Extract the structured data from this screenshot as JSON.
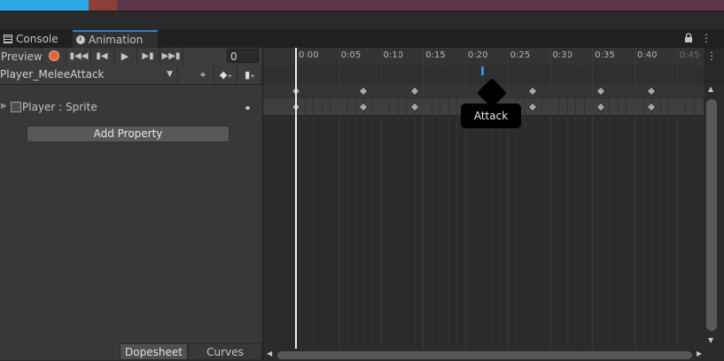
{
  "tabs": [
    {
      "label": "Console",
      "icon": "console-icon"
    },
    {
      "label": "Animation",
      "icon": "animation-icon",
      "active": true
    }
  ],
  "tab_icons": {
    "lock": "lock-icon",
    "menu": "menu-icon"
  },
  "toolbar": {
    "preview_label": "Preview",
    "record_icon": "record-icon",
    "first_key_icon": "first-keyframe-icon",
    "prev_key_icon": "previous-keyframe-icon",
    "play_icon": "play-icon",
    "next_key_icon": "next-keyframe-icon",
    "last_key_icon": "last-keyframe-icon",
    "frame_value": "0"
  },
  "clip": {
    "selected": "Player_MeleeAttack",
    "filter_icon": "filter-keyframe-icon",
    "add_keyframe_icon": "add-keyframe-icon",
    "add_event_icon": "add-event-icon"
  },
  "properties": [
    {
      "label": "Player : Sprite",
      "icon": "sprite-icon"
    }
  ],
  "add_property_label": "Add Property",
  "bottom_tabs": {
    "dopesheet": "Dopesheet",
    "curves": "Curves"
  },
  "timeline": {
    "tick_labels": [
      "0:00",
      "0:05",
      "0:10",
      "0:15",
      "0:20",
      "0:25",
      "0:30",
      "0:35",
      "0:40",
      "0:45"
    ],
    "playhead_frame": 0,
    "event": {
      "frame": 22,
      "tooltip": "Attack"
    },
    "keyframes": [
      0,
      8,
      14,
      28,
      36,
      42
    ]
  },
  "colors": {
    "accent": "#3a79bb",
    "record": "#e6623f",
    "event_marker": "#3c8ee6",
    "tooltip_bg": "#000000"
  }
}
